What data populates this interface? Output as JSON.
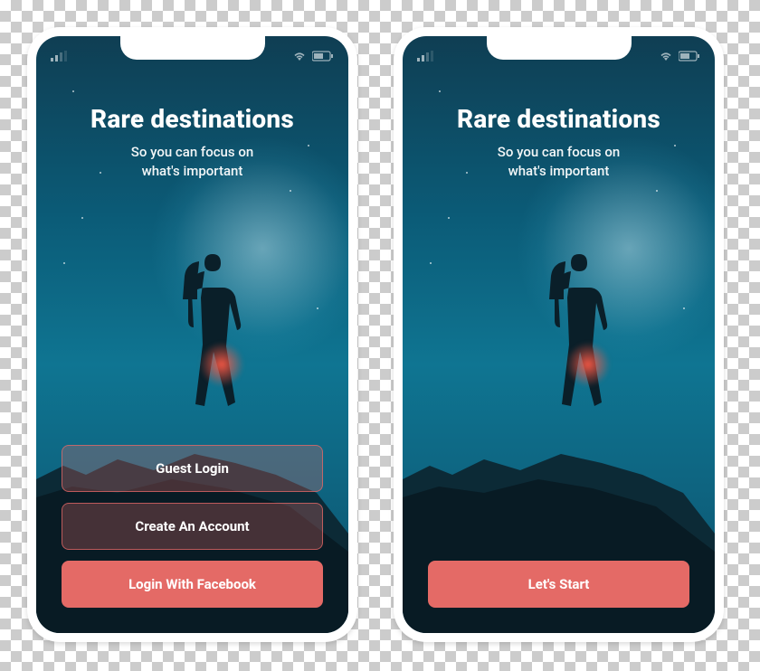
{
  "hero": {
    "title": "Rare destinations",
    "subtitle_line1": "So you can focus on",
    "subtitle_line2": "what's important"
  },
  "screen1": {
    "buttons": {
      "guest": "Guest Login",
      "create": "Create An Account",
      "facebook": "Login With Facebook"
    }
  },
  "screen2": {
    "buttons": {
      "start": "Let's Start"
    }
  },
  "colors": {
    "accent": "#e46a66",
    "accent_ghost_bg": "rgba(229,106,104,0.28)",
    "accent_ghost_border": "rgba(229,106,104,0.75)"
  }
}
